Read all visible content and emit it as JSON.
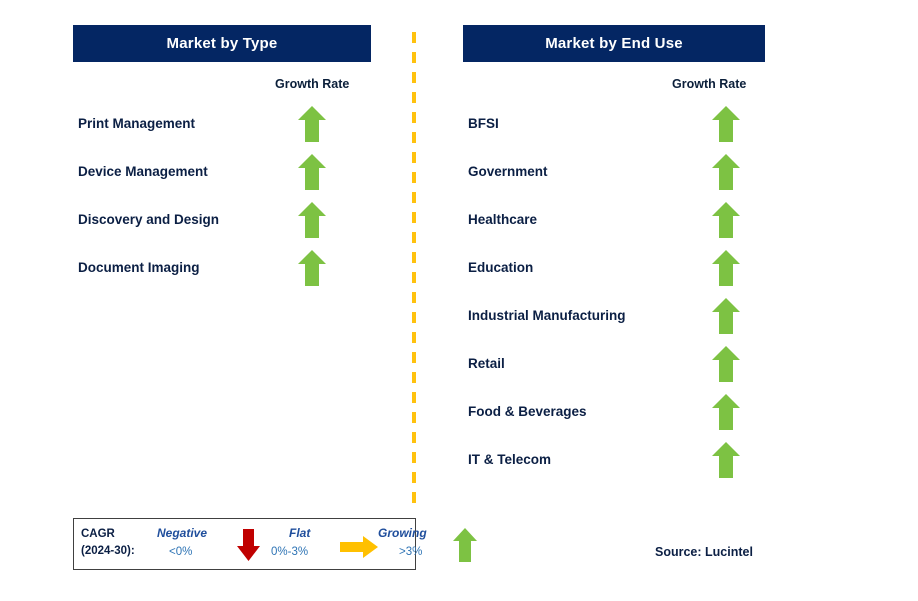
{
  "columns": [
    {
      "id": "market-by-type",
      "title": "Market by Type",
      "growth_rate_label": "Growth Rate",
      "rows": [
        {
          "label": "Print Management",
          "trend": "growing"
        },
        {
          "label": "Device Management",
          "trend": "growing"
        },
        {
          "label": "Discovery and Design",
          "trend": "growing"
        },
        {
          "label": "Document Imaging",
          "trend": "growing"
        }
      ]
    },
    {
      "id": "market-by-end-use",
      "title": "Market by End Use",
      "growth_rate_label": "Growth Rate",
      "rows": [
        {
          "label": "BFSI",
          "trend": "growing"
        },
        {
          "label": "Government",
          "trend": "growing"
        },
        {
          "label": "Healthcare",
          "trend": "growing"
        },
        {
          "label": "Education",
          "trend": "growing"
        },
        {
          "label": "Industrial Manufacturing",
          "trend": "growing"
        },
        {
          "label": "Retail",
          "trend": "growing"
        },
        {
          "label": "Food & Beverages",
          "trend": "growing"
        },
        {
          "label": "IT & Telecom",
          "trend": "growing"
        }
      ]
    }
  ],
  "legend": {
    "title_line1": "CAGR",
    "title_line2": "(2024-30):",
    "items": [
      {
        "name": "Negative",
        "value": "<0%",
        "icon": "arrow-down-icon",
        "color": "#C00000"
      },
      {
        "name": "Flat",
        "value": "0%-3%",
        "icon": "arrow-right-icon",
        "color": "#FFC000"
      },
      {
        "name": "Growing",
        "value": ">3%",
        "icon": "arrow-up-icon",
        "color": "#7DC243"
      }
    ]
  },
  "source": "Source: Lucintel",
  "colors": {
    "header_navy": "#042663",
    "label_navy": "#0b1f44",
    "growing_green": "#7DC243",
    "flat_amber": "#FFC000",
    "negative_red": "#C00000",
    "divider_orange": "#FFC20E"
  }
}
